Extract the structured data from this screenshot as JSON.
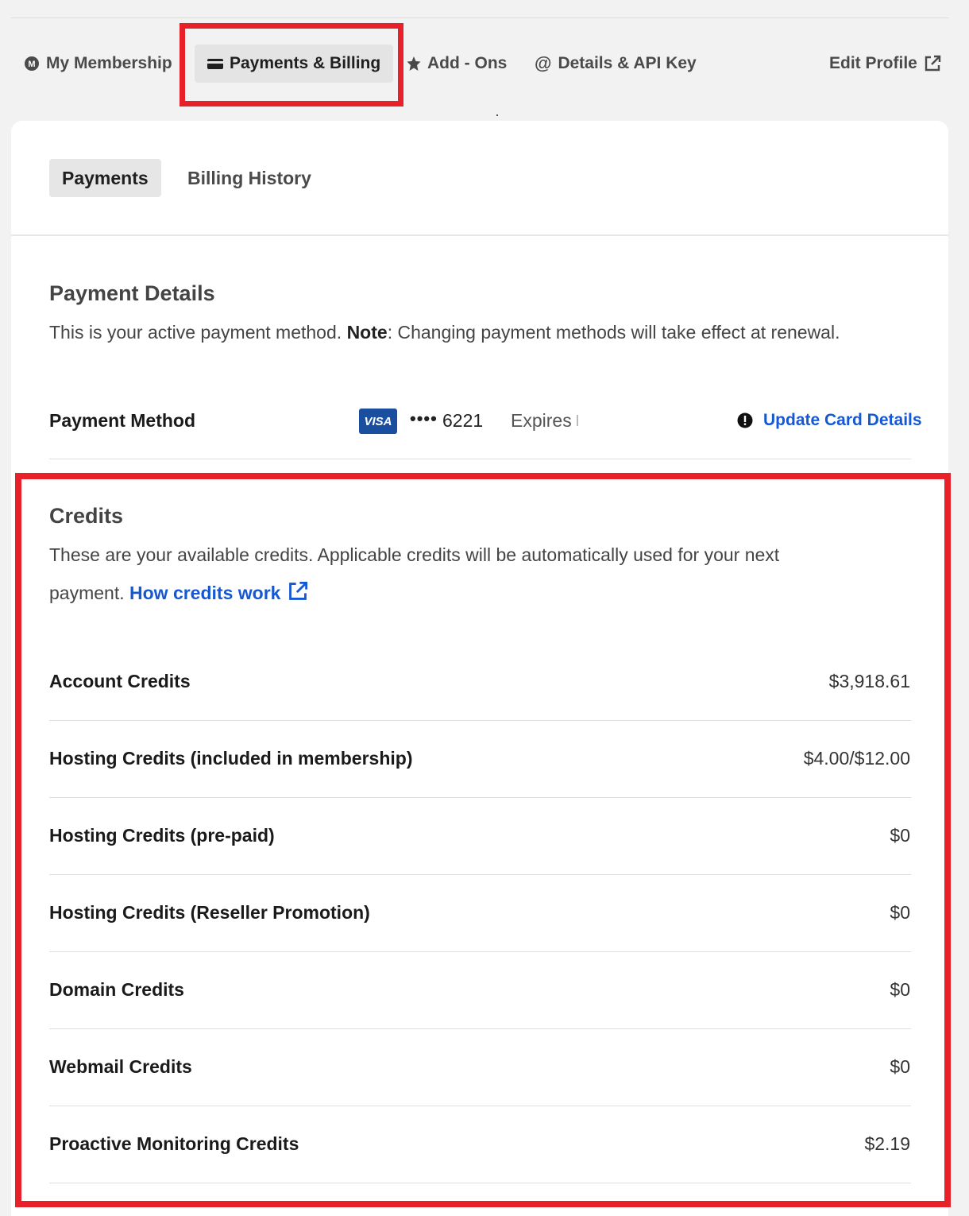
{
  "nav": {
    "membership": "My Membership",
    "payments_billing": "Payments & Billing",
    "addons": "Add - Ons",
    "details_api": "Details & API Key",
    "edit_profile": "Edit Profile"
  },
  "subtabs": {
    "payments": "Payments",
    "billing_history": "Billing History"
  },
  "payment_details": {
    "title": "Payment Details",
    "desc_before": "This is your active payment method. ",
    "desc_note": "Note",
    "desc_after": ": Changing payment methods will take effect at renewal.",
    "method_label": "Payment Method",
    "card_brand": "VISA",
    "card_dots": "••••",
    "card_last4": "6221",
    "expires": "Expires",
    "update_link": "Update Card Details"
  },
  "credits": {
    "title": "Credits",
    "desc_line1": "These are your available credits. Applicable credits will be automatically used for your next",
    "desc_line2": "payment. ",
    "how_link": "How credits work",
    "rows": [
      {
        "label": "Account Credits",
        "value": "$3,918.61"
      },
      {
        "label": "Hosting Credits (included in membership)",
        "value": "$4.00/$12.00"
      },
      {
        "label": "Hosting Credits (pre-paid)",
        "value": "$0"
      },
      {
        "label": "Hosting Credits (Reseller Promotion)",
        "value": "$0"
      },
      {
        "label": "Domain Credits",
        "value": "$0"
      },
      {
        "label": "Webmail Credits",
        "value": "$0"
      },
      {
        "label": "Proactive Monitoring Credits",
        "value": "$2.19"
      }
    ]
  },
  "colors": {
    "accent_link": "#1558d6",
    "highlight": "#e8202a",
    "visa_blue": "#1a4fa0"
  }
}
